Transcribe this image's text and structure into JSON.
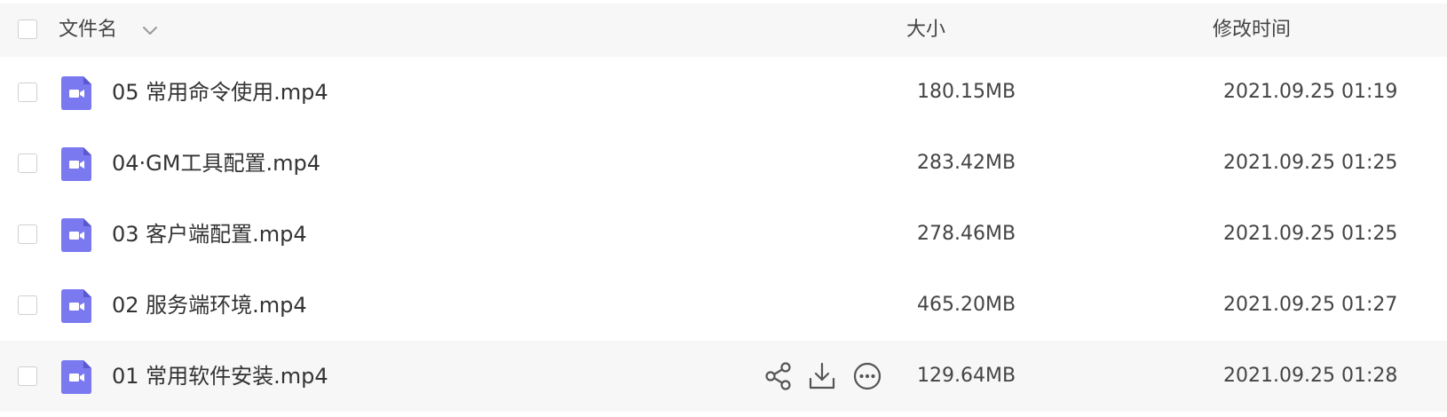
{
  "header": {
    "name_label": "文件名",
    "size_label": "大小",
    "time_label": "修改时间"
  },
  "files": [
    {
      "name": "05 常用命令使用.mp4",
      "size": "180.15MB",
      "modified": "2021.09.25 01:19"
    },
    {
      "name": "04·GM工具配置.mp4",
      "size": "283.42MB",
      "modified": "2021.09.25 01:25"
    },
    {
      "name": "03 客户端配置.mp4",
      "size": "278.46MB",
      "modified": "2021.09.25 01:25"
    },
    {
      "name": "02 服务端环境.mp4",
      "size": "465.20MB",
      "modified": "2021.09.25 01:27"
    },
    {
      "name": "01 常用软件安装.mp4",
      "size": "129.64MB",
      "modified": "2021.09.25 01:28"
    }
  ],
  "hover_actions": [
    "share-icon",
    "download-icon",
    "more-icon"
  ],
  "colors": {
    "video_icon": "#7b79f0",
    "header_bg": "#f7f7f7",
    "hover_bg": "#f7f7f7",
    "icon_gray": "#555555"
  }
}
